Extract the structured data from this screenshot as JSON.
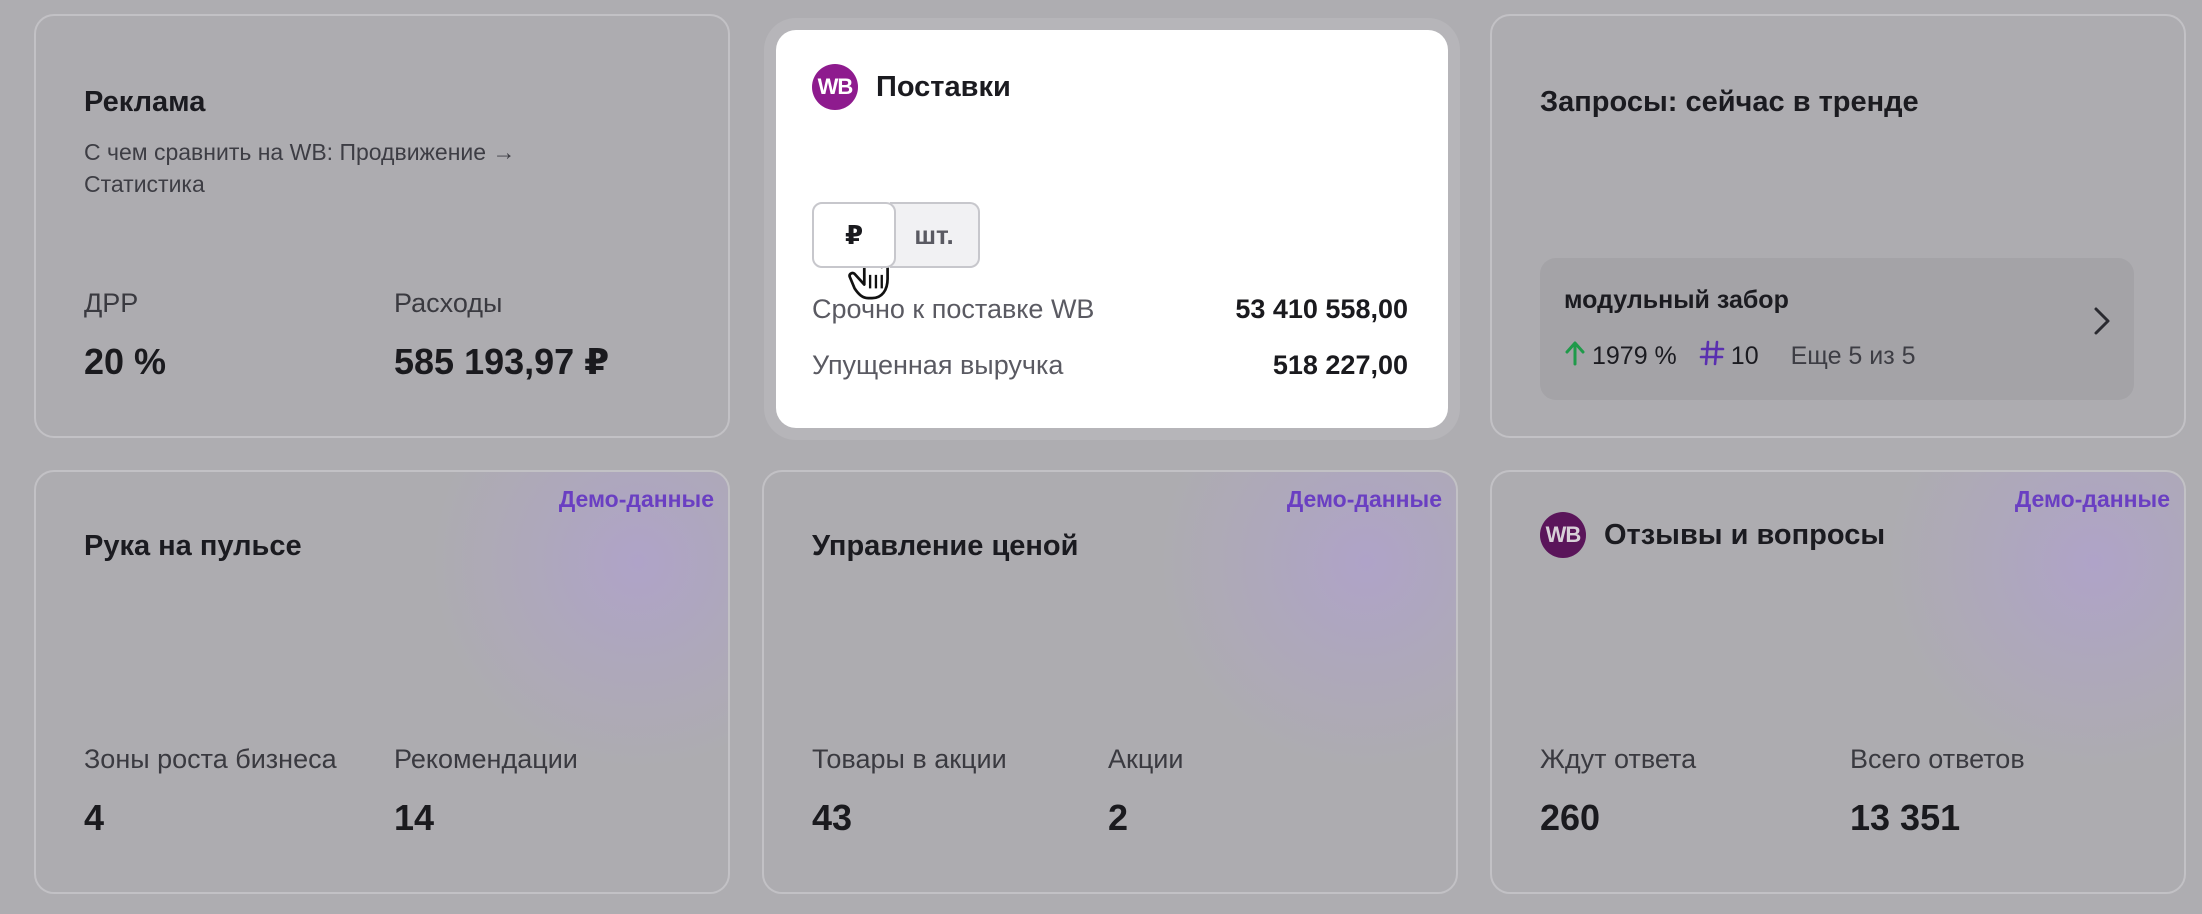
{
  "cards": {
    "ads": {
      "title": "Реклама",
      "subtitle": "С чем сравнить на WB: Продвижение → Статистика",
      "metrics": [
        {
          "label": "ДРР",
          "value": "20 %"
        },
        {
          "label": "Расходы",
          "value": "585 193,97 ₽"
        }
      ]
    },
    "supplies": {
      "logo": "WB",
      "title": "Поставки",
      "toggle": [
        "₽",
        "шт."
      ],
      "rows": [
        {
          "label": "Срочно к поставке WB",
          "value": "53 410 558,00"
        },
        {
          "label": "Упущенная выручка",
          "value": "518 227,00"
        }
      ]
    },
    "trends": {
      "title": "Запросы: сейчас в тренде",
      "item": {
        "query": "модульный забор",
        "growth": "1979 %",
        "rank": "10",
        "more": "Еще 5 из 5"
      }
    },
    "pulse": {
      "badge": "Демо-данные",
      "title": "Рука на пульсе",
      "metrics": [
        {
          "label": "Зоны роста бизнеса",
          "value": "4"
        },
        {
          "label": "Рекомендации",
          "value": "14"
        }
      ]
    },
    "price": {
      "badge": "Демо-данные",
      "title": "Управление ценой",
      "metrics": [
        {
          "label": "Товары в акции",
          "value": "43"
        },
        {
          "label": "Акции",
          "value": "2"
        }
      ]
    },
    "reviews": {
      "badge": "Демо-данные",
      "logo": "WB",
      "title": "Отзывы и вопросы",
      "metrics": [
        {
          "label": "Ждут ответа",
          "value": "260"
        },
        {
          "label": "Всего ответов",
          "value": "13 351"
        }
      ]
    }
  },
  "colors": {
    "background": "#aeadb1",
    "accent": "#6a3fc2",
    "wb_brand": "#8e1b8e",
    "growth": "#1f9a4a"
  },
  "icons": {
    "growth": "arrow-up-icon",
    "rank": "hash-icon",
    "next": "chevron-right-icon",
    "pointer": "hand-cursor-icon"
  }
}
